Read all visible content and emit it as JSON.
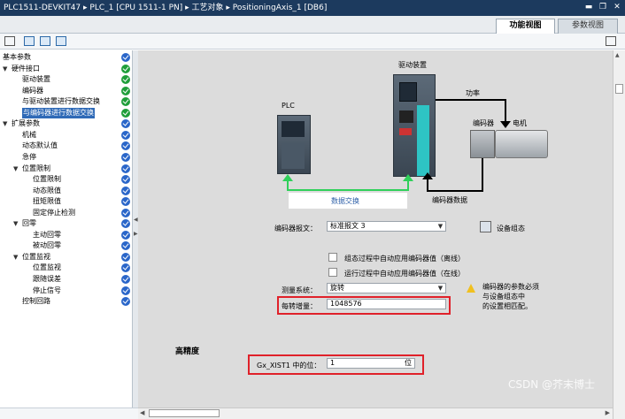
{
  "window": {
    "title": "PLC1511-DEVKIT47 ▸ PLC_1 [CPU 1511-1 PN] ▸ 工艺对象 ▸ PositioningAxis_1 [DB6]",
    "controls": [
      "▬",
      "❐",
      "✕"
    ]
  },
  "tabs": [
    {
      "label": "功能视图",
      "active": true
    },
    {
      "label": "参数视图",
      "active": false
    }
  ],
  "tree": [
    {
      "label": "基本参数",
      "level": 0,
      "expander": "",
      "status": "blue"
    },
    {
      "label": "硬件接口",
      "level": 0,
      "expander": "▼",
      "status": "green"
    },
    {
      "label": "驱动装置",
      "level": 1,
      "expander": "",
      "status": "green"
    },
    {
      "label": "编码器",
      "level": 1,
      "expander": "",
      "status": "green"
    },
    {
      "label": "与驱动装置进行数据交换",
      "level": 1,
      "expander": "",
      "status": "green"
    },
    {
      "label": "与编码器进行数据交换",
      "level": 1,
      "expander": "",
      "status": "green",
      "selected": true
    },
    {
      "label": "扩展参数",
      "level": 0,
      "expander": "▼",
      "status": "blue"
    },
    {
      "label": "机械",
      "level": 1,
      "expander": "",
      "status": "blue"
    },
    {
      "label": "动态默认值",
      "level": 1,
      "expander": "",
      "status": "blue"
    },
    {
      "label": "急停",
      "level": 1,
      "expander": "",
      "status": "blue"
    },
    {
      "label": "位置限制",
      "level": 1,
      "expander": "▼",
      "status": "blue"
    },
    {
      "label": "位置限制",
      "level": 2,
      "expander": "",
      "status": "blue"
    },
    {
      "label": "动态限值",
      "level": 2,
      "expander": "",
      "status": "blue"
    },
    {
      "label": "扭矩限值",
      "level": 2,
      "expander": "",
      "status": "blue"
    },
    {
      "label": "固定停止检测",
      "level": 2,
      "expander": "",
      "status": "blue"
    },
    {
      "label": "回零",
      "level": 1,
      "expander": "▼",
      "status": "blue"
    },
    {
      "label": "主动回零",
      "level": 2,
      "expander": "",
      "status": "blue"
    },
    {
      "label": "被动回零",
      "level": 2,
      "expander": "",
      "status": "blue"
    },
    {
      "label": "位置监视",
      "level": 1,
      "expander": "▼",
      "status": "blue"
    },
    {
      "label": "位置监视",
      "level": 2,
      "expander": "",
      "status": "blue"
    },
    {
      "label": "跟随误差",
      "level": 2,
      "expander": "",
      "status": "blue"
    },
    {
      "label": "停止信号",
      "level": 2,
      "expander": "",
      "status": "blue"
    },
    {
      "label": "控制回路",
      "level": 1,
      "expander": "",
      "status": "blue"
    }
  ],
  "diagram": {
    "drive_label": "驱动装置",
    "plc_label": "PLC",
    "power_label": "功率",
    "encoder_label": "编码器",
    "motor_label": "电机",
    "data_exchange_label": "数据交换",
    "encoder_data_label": "编码器数据"
  },
  "form": {
    "encoder_telegram_label": "编码器报文：",
    "encoder_telegram_value": "标准报文 3",
    "device_config_label": "设备组态",
    "auto_apply_offline_label": "组态过程中自动应用编码器值（离线）",
    "auto_apply_online_label": "运行过程中自动应用编码器值（在线）",
    "measuring_system_label": "测量系统：",
    "measuring_system_value": "旋转",
    "increments_label": "每转增量：",
    "increments_value": "1048576",
    "warning_text_1": "编码器的参数必须",
    "warning_text_2": "与设备组态中",
    "warning_text_3": "的设置相匹配。",
    "high_precision_title": "高精度",
    "gx_xist1_label": "Gx_XIST1 中的位：",
    "gx_xist1_value": "1",
    "gx_xist1_unit": "位"
  },
  "watermark": "CSDN @芥末博士"
}
